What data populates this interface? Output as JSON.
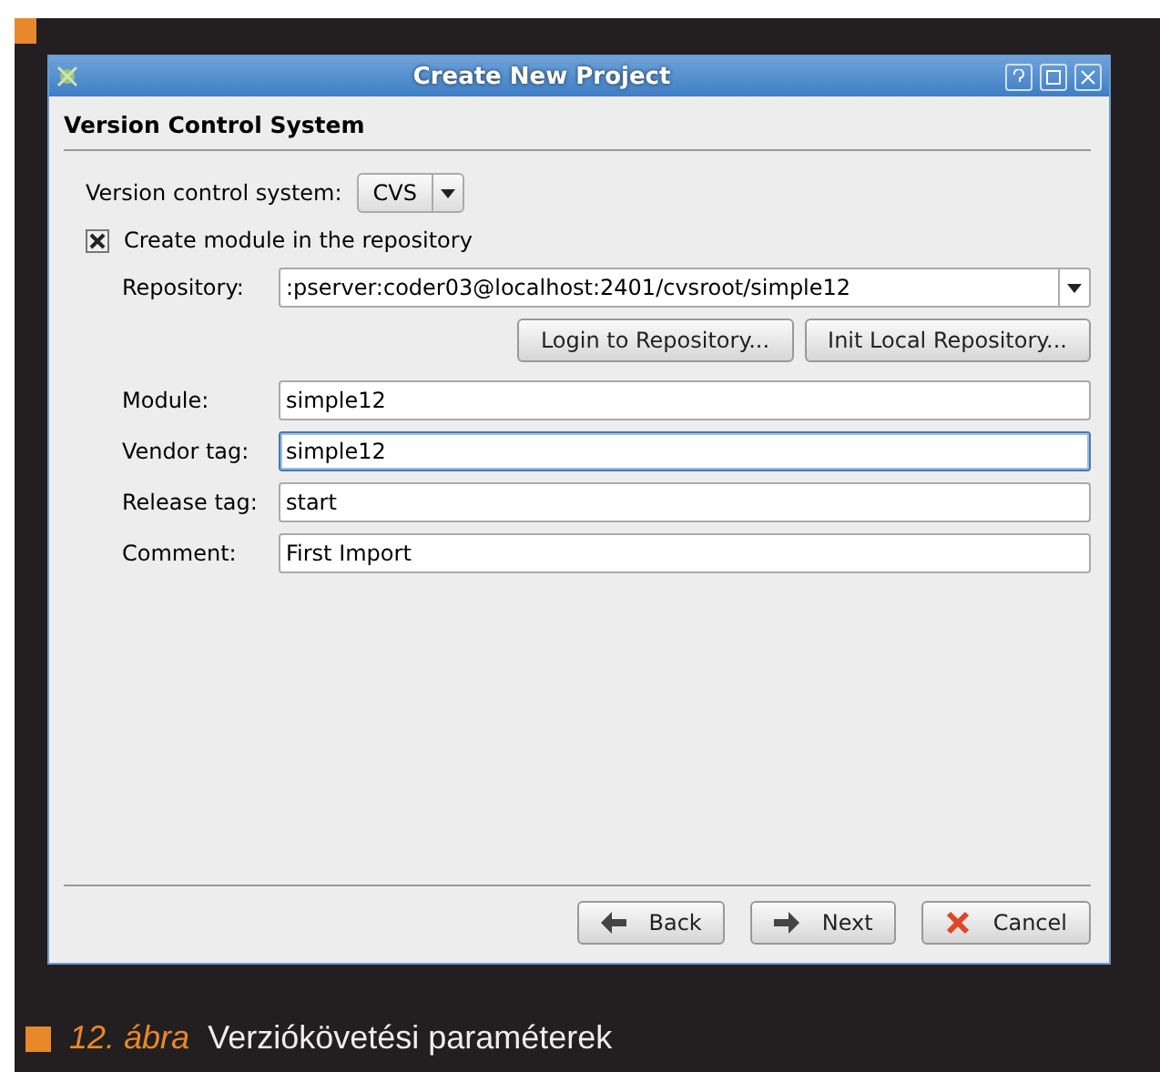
{
  "window": {
    "title": "Create New Project"
  },
  "section_title": "Version Control System",
  "vcs": {
    "label": "Version control system:",
    "value": "CVS"
  },
  "create_module": {
    "label": "Create module in the repository",
    "checked": true
  },
  "repository": {
    "label": "Repository:",
    "value": ":pserver:coder03@localhost:2401/cvsroot/simple12"
  },
  "repo_buttons": [
    "Login to Repository...",
    "Init Local Repository..."
  ],
  "fields": [
    {
      "label": "Module:",
      "value": "simple12",
      "focused": false
    },
    {
      "label": "Vendor tag:",
      "value": "simple12",
      "focused": true
    },
    {
      "label": "Release tag:",
      "value": "start",
      "focused": false
    },
    {
      "label": "Comment:",
      "value": "First Import",
      "focused": false
    }
  ],
  "buttons": [
    {
      "kind": "back",
      "label": "Back"
    },
    {
      "kind": "next",
      "label": "Next"
    },
    {
      "kind": "cancel",
      "label": "Cancel"
    }
  ],
  "caption": {
    "number": "12. ábra",
    "text": "Verziókövetési paraméterek"
  }
}
